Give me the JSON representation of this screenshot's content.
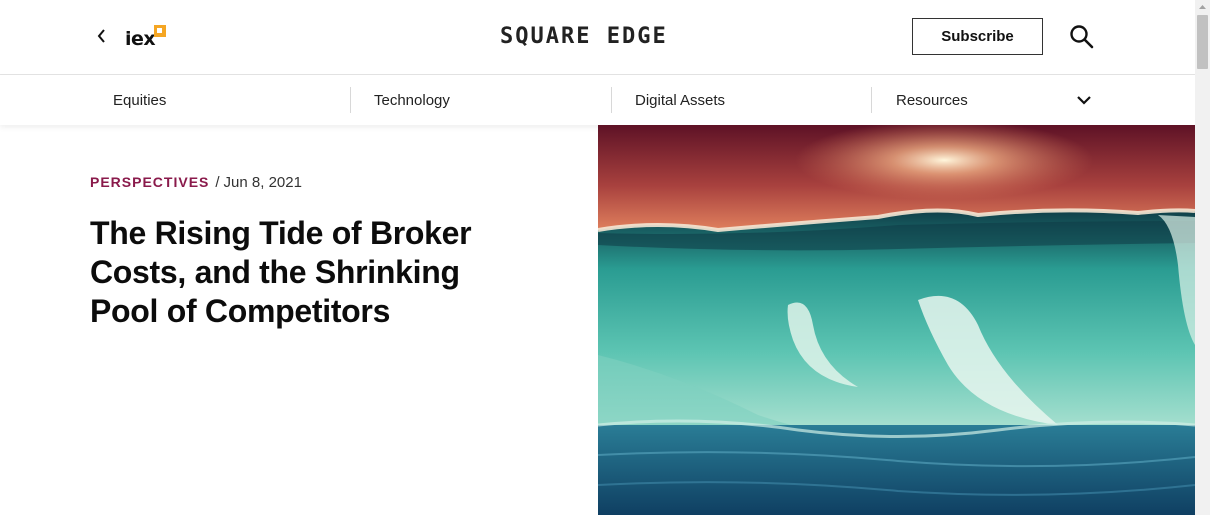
{
  "header": {
    "logo_text": "iex",
    "brand": "SQUARE EDGE",
    "subscribe_label": "Subscribe"
  },
  "nav": {
    "items": [
      {
        "label": "Equities"
      },
      {
        "label": "Technology"
      },
      {
        "label": "Digital Assets"
      },
      {
        "label": "Resources"
      }
    ]
  },
  "article": {
    "category": "PERSPECTIVES",
    "date_separator": "/",
    "date": "Jun 8, 2021",
    "title": "The Rising Tide of Broker Costs, and the Shrinking Pool of Competitors"
  },
  "colors": {
    "category": "#8a1a4b",
    "logo_accent": "#f5a623",
    "sky_top": "#6e1a2c",
    "sky_glow": "#e7825a",
    "wave": "#2aa8a0",
    "ocean": "#1c5a7a"
  },
  "icons": {
    "back": "chevron-left-icon",
    "search": "search-icon",
    "nav_more": "chevron-down-icon"
  }
}
